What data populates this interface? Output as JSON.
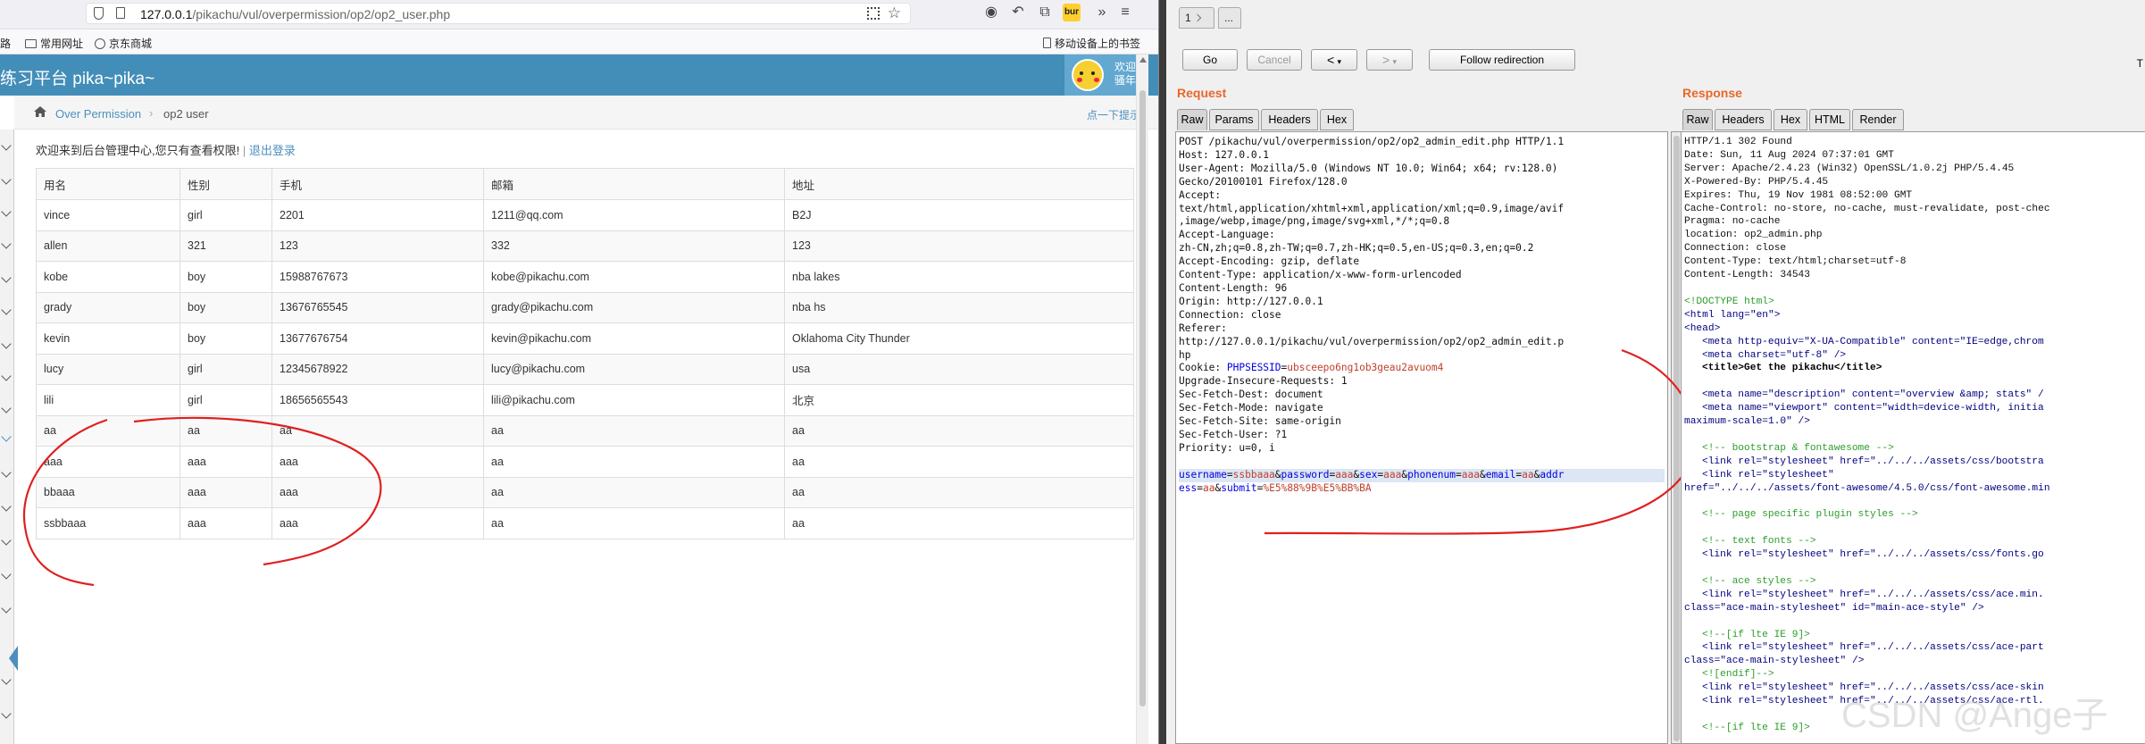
{
  "browser": {
    "url_host": "127.0.0.1",
    "url_path": "/pikachu/vul/overpermission/op2/op2_user.php",
    "toolbar_icons": [
      "qr-code-icon",
      "bookmark-star-icon",
      "account-icon",
      "undo-icon",
      "extension-icon",
      "burp-extension-icon",
      "overflow-icon"
    ],
    "burp_badge": "bur",
    "bookmarks": {
      "left_cut": "路",
      "common": "常用网址",
      "jd": "京东商城",
      "mobile": "移动设备上的书签"
    }
  },
  "site": {
    "brand": "练习平台 pika~pika~",
    "welcome_line1": "欢迎",
    "welcome_line2": "骚年",
    "breadcrumb": {
      "home": "Over Permission",
      "current": "op2 user"
    },
    "hint": "点一下提示~",
    "greeting": "欢迎来到后台管理中心,您只有查看权限!",
    "logout": "退出登录",
    "table": {
      "headers": [
        "用名",
        "性别",
        "手机",
        "邮箱",
        "地址"
      ],
      "rows": [
        [
          "vince",
          "girl",
          "2201",
          "1211@qq.com",
          "B2J"
        ],
        [
          "allen",
          "321",
          "123",
          "332",
          "123"
        ],
        [
          "kobe",
          "boy",
          "15988767673",
          "kobe@pikachu.com",
          "nba lakes"
        ],
        [
          "grady",
          "boy",
          "13676765545",
          "grady@pikachu.com",
          "nba hs"
        ],
        [
          "kevin",
          "boy",
          "13677676754",
          "kevin@pikachu.com",
          "Oklahoma City Thunder"
        ],
        [
          "lucy",
          "girl",
          "12345678922",
          "lucy@pikachu.com",
          "usa"
        ],
        [
          "lili",
          "girl",
          "18656565543",
          "lili@pikachu.com",
          "北京"
        ],
        [
          "aa",
          "aa",
          "aa",
          "aa",
          "aa"
        ],
        [
          "aaa",
          "aaa",
          "aaa",
          "aa",
          "aa"
        ],
        [
          "bbaaa",
          "aaa",
          "aaa",
          "aa",
          "aa"
        ],
        [
          "ssbbaaa",
          "aaa",
          "aaa",
          "aa",
          "aa"
        ]
      ]
    }
  },
  "burp": {
    "tab_label": "1",
    "tab_more": "...",
    "go": "Go",
    "cancel": "Cancel",
    "back": "<",
    "forward": ">",
    "follow": "Follow redirection",
    "target_cut": "T",
    "request_title": "Request",
    "response_title": "Response",
    "request_tabs": [
      "Raw",
      "Params",
      "Headers",
      "Hex"
    ],
    "response_tabs": [
      "Raw",
      "Headers",
      "Hex",
      "HTML",
      "Render"
    ],
    "request_lines": [
      "POST /pikachu/vul/overpermission/op2/op2_admin_edit.php HTTP/1.1",
      "Host: 127.0.0.1",
      "User-Agent: Mozilla/5.0 (Windows NT 10.0; Win64; x64; rv:128.0)",
      "Gecko/20100101 Firefox/128.0",
      "Accept:",
      "text/html,application/xhtml+xml,application/xml;q=0.9,image/avif",
      ",image/webp,image/png,image/svg+xml,*/*;q=0.8",
      "Accept-Language:",
      "zh-CN,zh;q=0.8,zh-TW;q=0.7,zh-HK;q=0.5,en-US;q=0.3,en;q=0.2",
      "Accept-Encoding: gzip, deflate",
      "Content-Type: application/x-www-form-urlencoded",
      "Content-Length: 96",
      "Origin: http://127.0.0.1",
      "Connection: close",
      "Referer:",
      "http://127.0.0.1/pikachu/vul/overpermission/op2/op2_admin_edit.p",
      "hp"
    ],
    "cookie_prefix": "Cookie: ",
    "cookie_name": "PHPSESSID",
    "cookie_value": "ubsceepo6ng1ob3geau2avuom4",
    "request_lines_2": [
      "Upgrade-Insecure-Requests: 1",
      "Sec-Fetch-Dest: document",
      "Sec-Fetch-Mode: navigate",
      "Sec-Fetch-Site: same-origin",
      "Sec-Fetch-User: ?1",
      "Priority: u=0, i"
    ],
    "body_line1": "username=ssbbaaa&password=aaa&sex=aaa&phonenum=aaa&email=aa&addr",
    "body_line2": "ess=aa&submit=%E5%88%9B%E5%BB%BA",
    "response_headers": [
      "HTTP/1.1 302 Found",
      "Date: Sun, 11 Aug 2024 07:37:01 GMT",
      "Server: Apache/2.4.23 (Win32) OpenSSL/1.0.2j PHP/5.4.45",
      "X-Powered-By: PHP/5.4.45",
      "Expires: Thu, 19 Nov 1981 08:52:00 GMT",
      "Cache-Control: no-store, no-cache, must-revalidate, post-chec",
      "Pragma: no-cache",
      "location: op2_admin.php",
      "Connection: close",
      "Content-Type: text/html;charset=utf-8",
      "Content-Length: 34543"
    ],
    "response_html": {
      "doctype": "<!DOCTYPE html>",
      "html_open": "<html lang=\"en\">",
      "head_open": "<head>",
      "meta1": "<meta http-equiv=\"X-UA-Compatible\" content=\"IE=edge,chrom",
      "meta2": "<meta charset=\"utf-8\" />",
      "title": "<title>Get the pikachu</title>",
      "meta3": "<meta name=\"description\" content=\"overview &amp; stats\" /",
      "meta4": "<meta name=\"viewport\" content=\"width=device-width, initia",
      "meta4b": "maximum-scale=1.0\" />",
      "c1": "<!-- bootstrap & fontawesome -->",
      "link1": "<link rel=\"stylesheet\" href=\"../../../assets/css/bootstra",
      "link2a": "<link rel=\"stylesheet\"",
      "link2b": "href=\"../../../assets/font-awesome/4.5.0/css/font-awesome.min",
      "c2": "<!-- page specific plugin styles -->",
      "c3": "<!-- text fonts -->",
      "link3": "<link rel=\"stylesheet\" href=\"../../../assets/css/fonts.go",
      "c4": "<!-- ace styles -->",
      "link4a": "<link rel=\"stylesheet\" href=\"../../../assets/css/ace.min.",
      "link4b": "class=\"ace-main-stylesheet\" id=\"main-ace-style\" />",
      "c5": "<!--[if lte IE 9]>",
      "link5a": "<link rel=\"stylesheet\" href=\"../../../assets/css/ace-part",
      "link5b": "class=\"ace-main-stylesheet\" />",
      "c6": "<![endif]-->",
      "link6": "<link rel=\"stylesheet\" href=\"../../../assets/css/ace-skin",
      "link7": "<link rel=\"stylesheet\" href=\"../../../assets/css/ace-rtl.",
      "c7": "<!--[if lte IE 9]>"
    }
  },
  "watermark": "CSDN @Ange子"
}
